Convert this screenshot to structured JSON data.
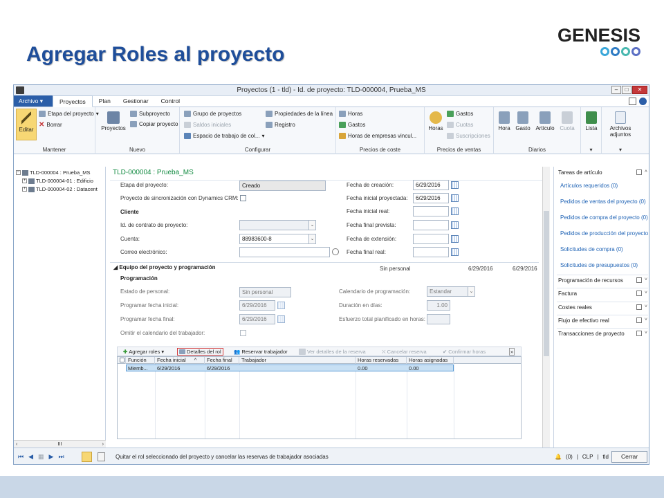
{
  "slide": {
    "title": "Agregar Roles al proyecto",
    "logo": "GENESIS"
  },
  "window": {
    "title": "Proyectos (1 - tld) - Id. de proyecto: TLD-000004, Prueba_MS"
  },
  "menu": {
    "archivo": "Archivo",
    "tabs": [
      "Proyectos",
      "Plan",
      "Gestionar",
      "Control"
    ]
  },
  "ribbon": {
    "mantener": {
      "label": "Mantener",
      "editar": "Editar",
      "etapa": "Etapa del proyecto",
      "borrar": "Borrar"
    },
    "nuevo": {
      "label": "Nuevo",
      "proyectos": "Proyectos",
      "subproyecto": "Subproyecto",
      "copiar": "Copiar proyecto"
    },
    "configurar": {
      "label": "Configurar",
      "grupo": "Grupo de proyectos",
      "saldos": "Saldos iniciales",
      "espacio": "Espacio de trabajo de col...",
      "propiedades": "Propiedades de la línea",
      "registro": "Registro"
    },
    "precios_coste": {
      "label": "Precios de coste",
      "horas": "Horas",
      "gastos": "Gastos",
      "empresas": "Horas de empresas vincul..."
    },
    "precios_venta": {
      "label": "Precios de ventas",
      "horas": "Horas",
      "gastos": "Gastos",
      "cuotas": "Cuotas",
      "suscripciones": "Suscripciones"
    },
    "diarios": {
      "label": "Diarios",
      "hora": "Hora",
      "gasto": "Gasto",
      "articulo": "Artículo",
      "cuota": "Cuota"
    },
    "otros": {
      "lista": "Lista",
      "archivos": "Archivos adjuntos"
    }
  },
  "tree": {
    "items": [
      "TLD-000004 : Prueba_MS",
      "TLD-000004-01 : Edificio",
      "TLD-000004-02 : Datacent"
    ]
  },
  "form": {
    "header": "TLD-000004 : Prueba_MS",
    "etapa_label": "Etapa del proyecto:",
    "etapa_value": "Creado",
    "sync_label": "Proyecto de sincronización con Dynamics CRM:",
    "cliente": "Cliente",
    "contrato_label": "Id. de contrato de proyecto:",
    "cuenta_label": "Cuenta:",
    "cuenta_value": "88983600-8",
    "correo_label": "Correo electrónico:",
    "creacion_label": "Fecha de creación:",
    "creacion_value": "6/29/2016",
    "inicial_proy_label": "Fecha inicial proyectada:",
    "inicial_proy_value": "6/29/2016",
    "inicial_real_label": "Fecha inicial real:",
    "final_prev_label": "Fecha final prevista:",
    "extension_label": "Fecha de extensión:",
    "final_real_label": "Fecha final real:",
    "equipo_section": "Equipo del proyecto y programación",
    "sin_personal_head": "Sin personal",
    "date_head_1": "6/29/2016",
    "date_head_2": "6/29/2016",
    "programacion": "Programación",
    "estado_label": "Estado de personal:",
    "estado_value": "Sin personal",
    "prog_ini_label": "Programar fecha inicial:",
    "prog_ini_value": "6/29/2016",
    "prog_fin_label": "Programar fecha final:",
    "prog_fin_value": "6/29/2016",
    "omitir_label": "Omitir el calendario del trabajador:",
    "calendario_label": "Calendario de programación:",
    "calendario_value": "Estandar",
    "duracion_label": "Duración en días:",
    "duracion_value": "1.00",
    "esfuerzo_label": "Esfuerzo total planificado en horas:"
  },
  "grid_toolbar": {
    "agregar": "Agregar roles",
    "detalles": "Detalles del rol",
    "reservar": "Reservar trabajador",
    "ver": "Ver detalles de la reserva",
    "cancelar": "Cancelar reserva",
    "confirmar": "Confirmar horas"
  },
  "grid": {
    "headers": [
      "Función",
      "Fecha inicial",
      "Fecha final",
      "Trabajador",
      "Horas reservadas",
      "Horas asignadas"
    ],
    "row": [
      "Miemb...",
      "6/29/2016",
      "6/29/2016",
      "",
      "0.00",
      "0.00"
    ]
  },
  "factbox": {
    "tareas": "Tareas de artículo",
    "links": [
      "Artículos requeridos (0)",
      "Pedidos de ventas del proyecto (0)",
      "Pedidos de compra del proyecto (0)",
      "Pedidos de producción del proyecto",
      "Solicitudes de compra (0)",
      "Solicitudes de presupuestos (0)"
    ],
    "sections": [
      "Programación de recursos",
      "Factura",
      "Costes reales",
      "Flujo de efectivo real",
      "Transacciones de proyecto"
    ]
  },
  "status": {
    "text": "Quitar el rol seleccionado del proyecto y cancelar las reservas de trabajador asociadas",
    "count": "(0)",
    "currency": "CLP",
    "company": "tld",
    "close": "Cerrar"
  }
}
